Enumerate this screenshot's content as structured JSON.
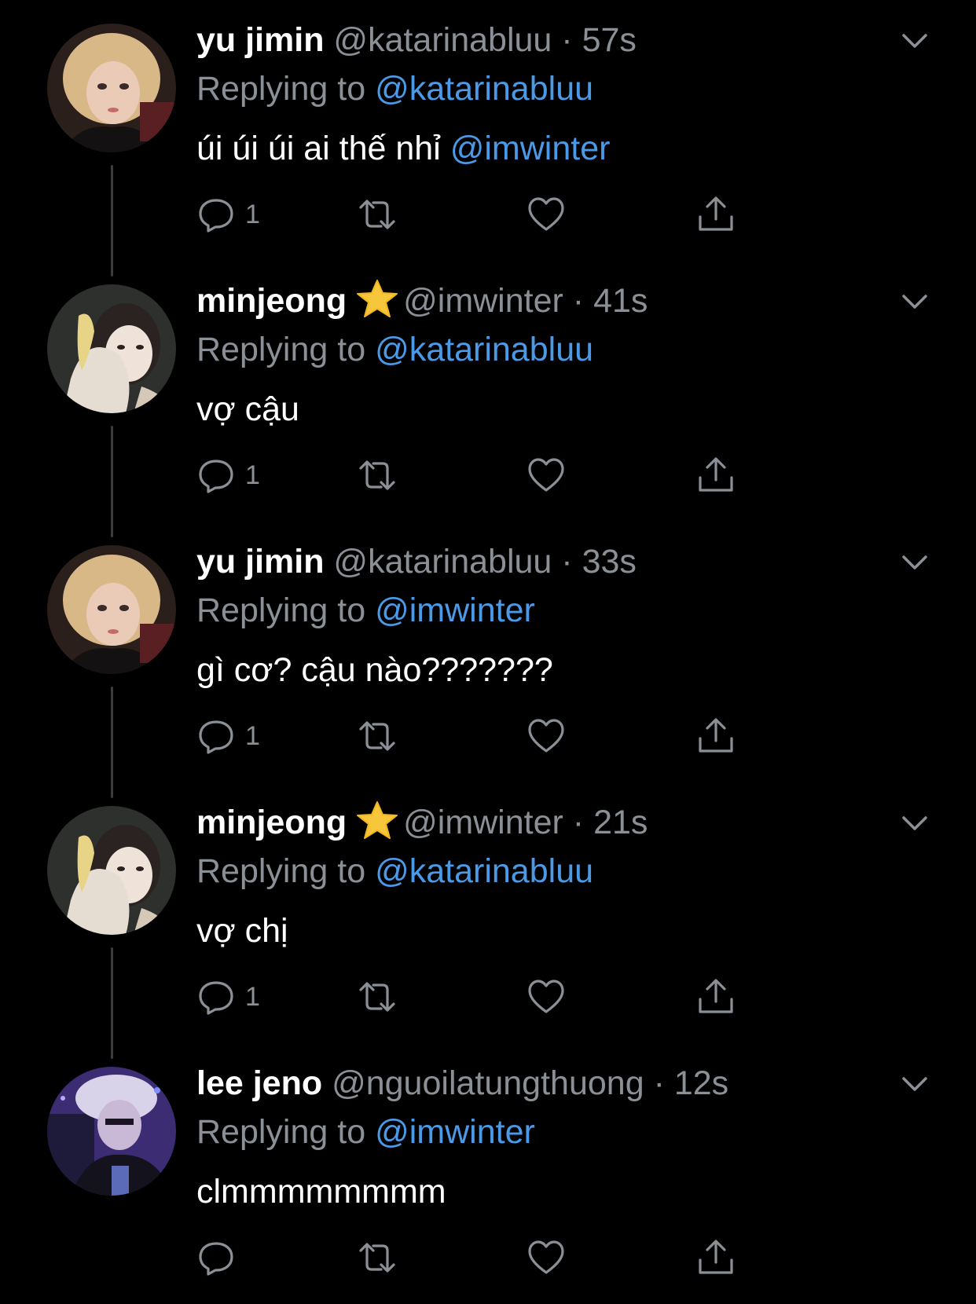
{
  "colors": {
    "background": "#000000",
    "text": "#ffffff",
    "muted": "#8b9096",
    "link": "#4a9ae8",
    "thread_line": "#3a3d40"
  },
  "tweets": [
    {
      "name": "yu jimin",
      "badge": "",
      "handle": "@katarinabluu",
      "time": "57s",
      "replying_label": "Replying to",
      "replying_to": "@katarinabluu",
      "text": "úi úi úi ai thế nhỉ",
      "mention": "@imwinter",
      "reply_count": "1",
      "avatar": "yujimin-avatar"
    },
    {
      "name": "minjeong",
      "badge": "star-emoji",
      "handle": "@imwinter",
      "time": "41s",
      "replying_label": "Replying to",
      "replying_to": "@katarinabluu",
      "text": "vợ cậu",
      "mention": "",
      "reply_count": "1",
      "avatar": "minjeong-avatar"
    },
    {
      "name": "yu jimin",
      "badge": "",
      "handle": "@katarinabluu",
      "time": "33s",
      "replying_label": "Replying to",
      "replying_to": "@imwinter",
      "text": "gì cơ? cậu nào???????",
      "mention": "",
      "reply_count": "1",
      "avatar": "yujimin-avatar"
    },
    {
      "name": "minjeong",
      "badge": "star-emoji",
      "handle": "@imwinter",
      "time": "21s",
      "replying_label": "Replying to",
      "replying_to": "@katarinabluu",
      "text": "vợ chị",
      "mention": "",
      "reply_count": "1",
      "avatar": "minjeong-avatar"
    },
    {
      "name": "lee jeno",
      "badge": "",
      "handle": "@nguoilatungthuong",
      "time": "12s",
      "replying_label": "Replying to",
      "replying_to": "@imwinter",
      "text": "clmmmmmmmm",
      "mention": "",
      "reply_count": "",
      "avatar": "leejeno-avatar"
    }
  ],
  "icons": {
    "reply": "speech-bubble-icon",
    "retweet": "retweet-icon",
    "like": "heart-icon",
    "share": "share-icon",
    "more": "chevron-down-icon"
  }
}
